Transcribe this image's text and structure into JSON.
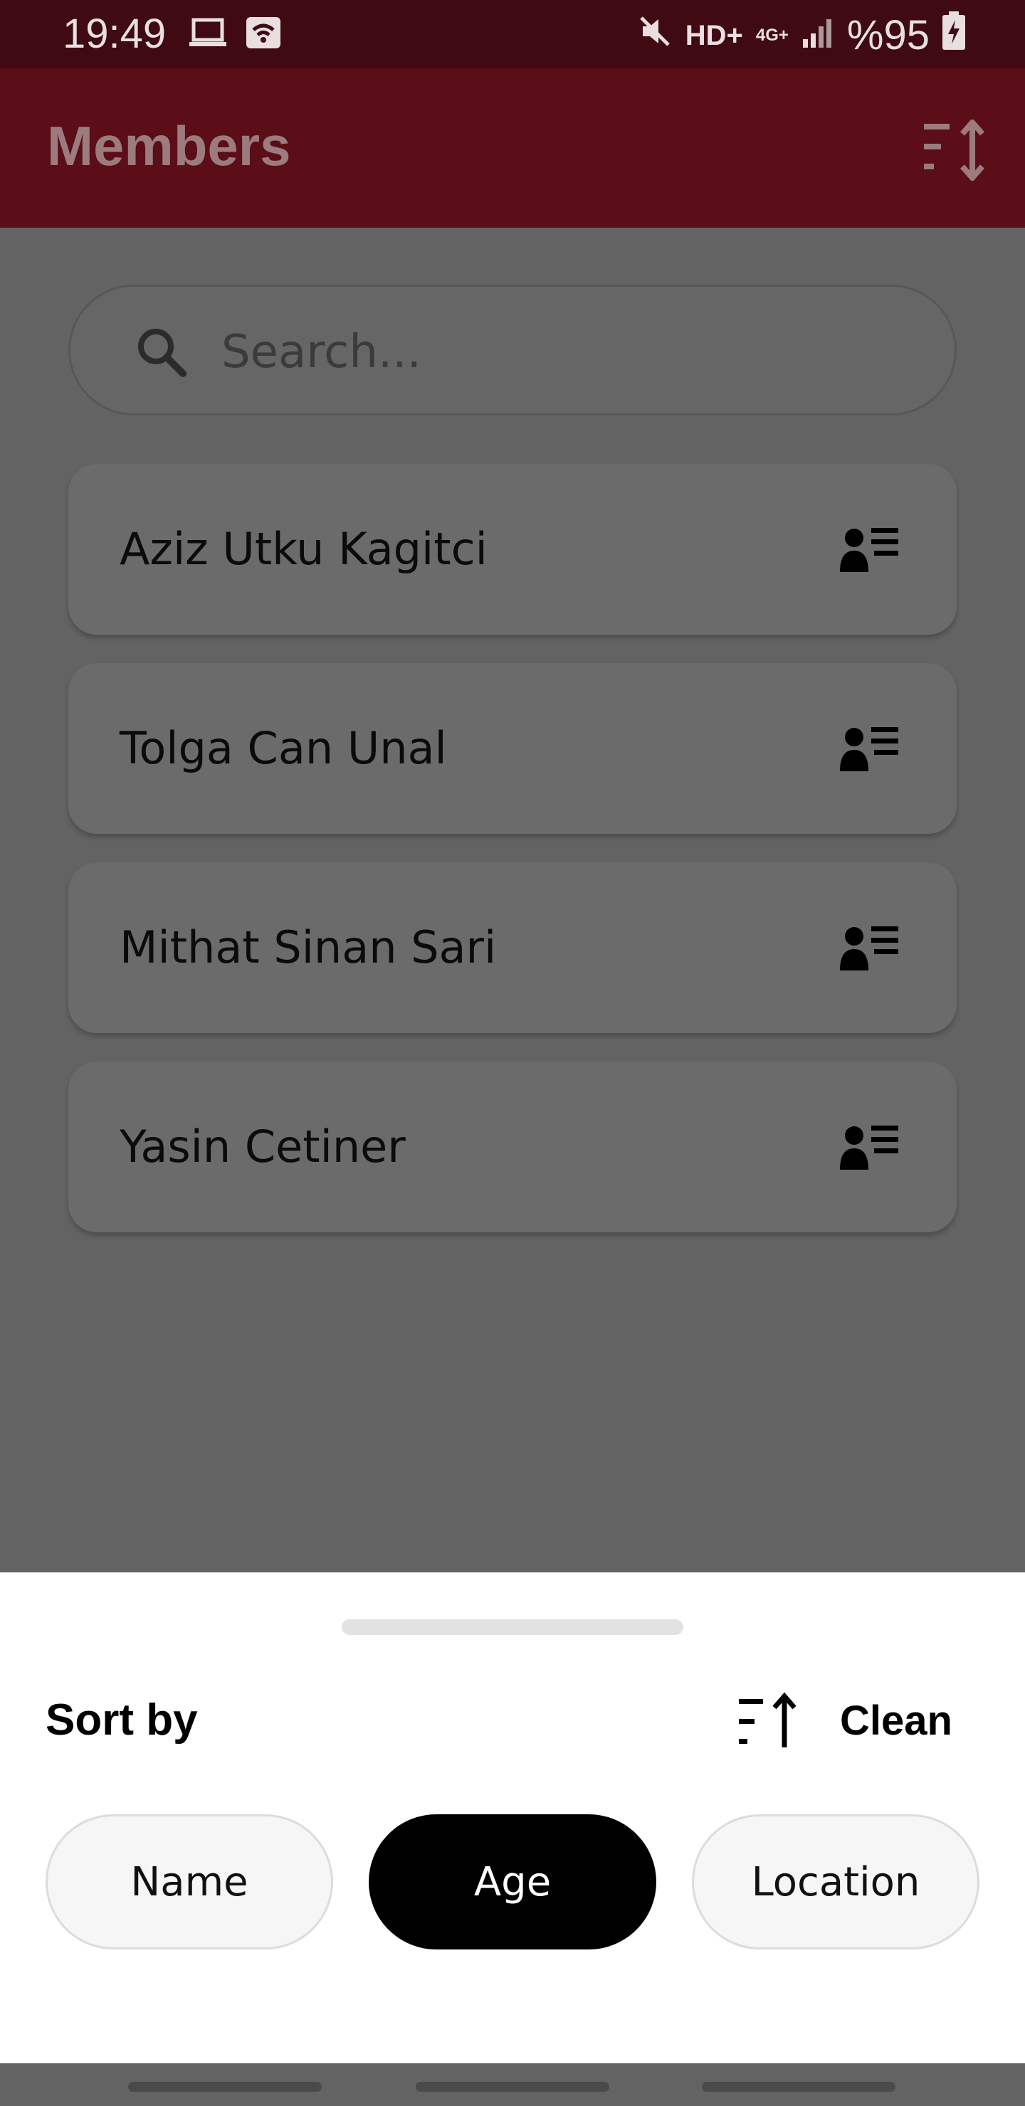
{
  "status_bar": {
    "time": "19:49",
    "icons_left": [
      "laptop-icon",
      "wifi-icon"
    ],
    "hd_label": "HD+",
    "network_label": "4G+",
    "battery_text": "%95",
    "icons_right": [
      "mute-icon",
      "signal-icon",
      "battery-icon"
    ]
  },
  "app_bar": {
    "title": "Members",
    "sort_icon": "sort-icon"
  },
  "search": {
    "placeholder": "Search..."
  },
  "members": [
    {
      "name": "Aziz Utku Kagitci",
      "icon": "member-details-icon"
    },
    {
      "name": "Tolga Can Unal",
      "icon": "member-details-icon"
    },
    {
      "name": "Mithat Sinan Sari",
      "icon": "member-details-icon"
    },
    {
      "name": "Yasin Cetiner",
      "icon": "member-details-icon"
    }
  ],
  "sort_sheet": {
    "title": "Sort by",
    "order_icon": "sort-ascending-icon",
    "clean_label": "Clean",
    "options": [
      {
        "label": "Name",
        "selected": false
      },
      {
        "label": "Age",
        "selected": true
      },
      {
        "label": "Location",
        "selected": false
      }
    ]
  },
  "colors": {
    "status_bar": "#3f0a12",
    "app_bar": "#5b0d18",
    "scrim_background": "#636363",
    "selected_chip": "#000000",
    "chip_background": "#f6f6f6"
  }
}
